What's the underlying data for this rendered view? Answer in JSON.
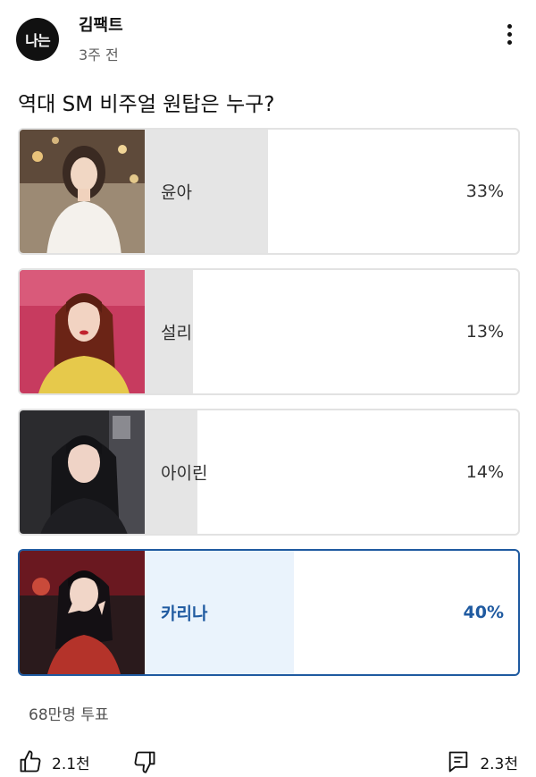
{
  "channel": {
    "avatar_text": "나는",
    "name": "김팩트",
    "time": "3주 전"
  },
  "poll": {
    "question": "역대 SM 비주얼 원탑은 누구?",
    "options": [
      {
        "label": "윤아",
        "percent": "33%",
        "value": 33,
        "selected": false
      },
      {
        "label": "설리",
        "percent": "13%",
        "value": 13,
        "selected": false
      },
      {
        "label": "아이린",
        "percent": "14%",
        "value": 14,
        "selected": false
      },
      {
        "label": "카리나",
        "percent": "40%",
        "value": 40,
        "selected": true
      }
    ],
    "total_votes": "68만명 투표"
  },
  "actions": {
    "likes": "2.1천",
    "comments": "2.3천"
  },
  "icons": [
    "more-vert-icon",
    "thumbs-up-icon",
    "thumbs-down-icon",
    "comment-icon"
  ],
  "colors": {
    "accent": "#1f5aa0",
    "fill": "#e5e5e5",
    "selected_fill": "#eaf3fc",
    "border": "#e2e2e2"
  }
}
